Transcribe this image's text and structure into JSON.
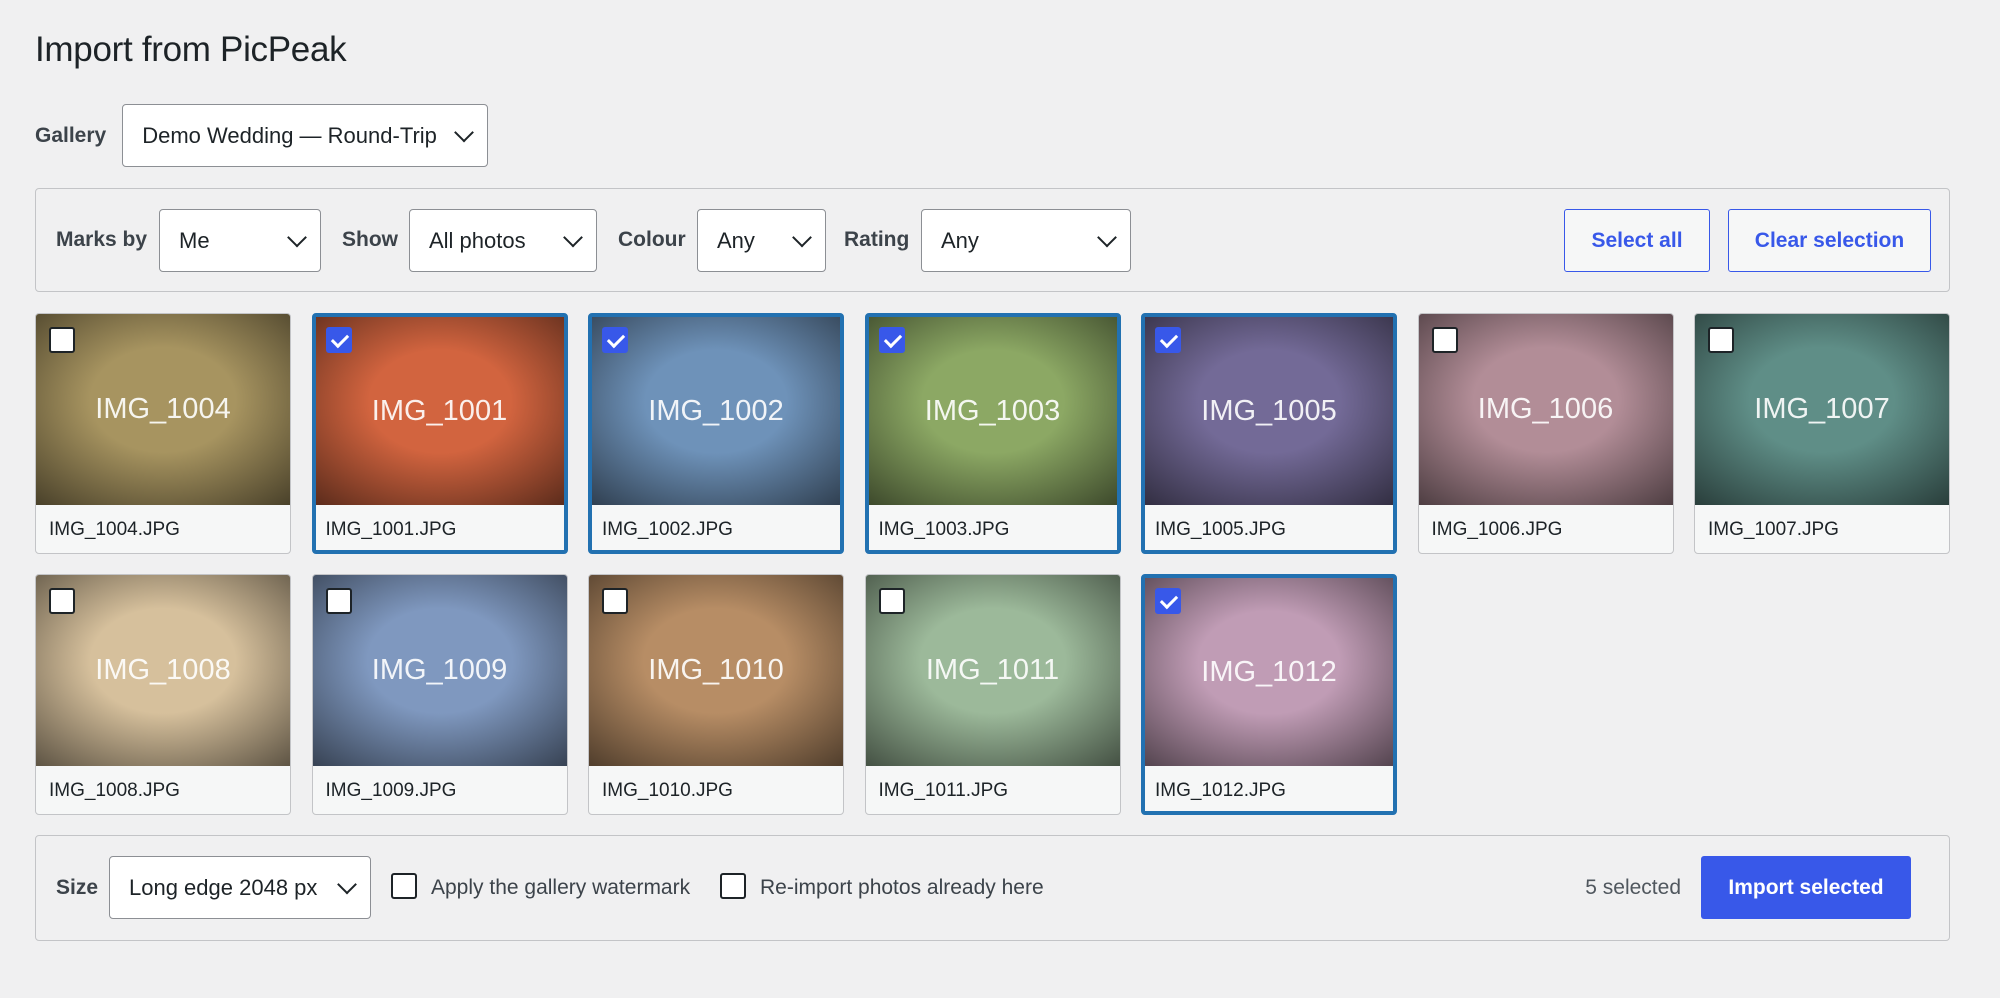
{
  "page": {
    "title": "Import from PicPeak"
  },
  "gallery": {
    "label": "Gallery",
    "value": "Demo Wedding — Round-Trip"
  },
  "filters": {
    "marks_by": {
      "label": "Marks by",
      "value": "Me"
    },
    "show": {
      "label": "Show",
      "value": "All photos"
    },
    "colour": {
      "label": "Colour",
      "value": "Any"
    },
    "rating": {
      "label": "Rating",
      "value": "Any"
    },
    "select_all_label": "Select all",
    "clear_selection_label": "Clear selection"
  },
  "photos": [
    {
      "thumb_label": "IMG_1004",
      "filename": "IMG_1004.JPG",
      "selected": false,
      "color": "#a79460"
    },
    {
      "thumb_label": "IMG_1001",
      "filename": "IMG_1001.JPG",
      "selected": true,
      "color": "#d2643f"
    },
    {
      "thumb_label": "IMG_1002",
      "filename": "IMG_1002.JPG",
      "selected": true,
      "color": "#6e92b9"
    },
    {
      "thumb_label": "IMG_1003",
      "filename": "IMG_1003.JPG",
      "selected": true,
      "color": "#8ca864"
    },
    {
      "thumb_label": "IMG_1005",
      "filename": "IMG_1005.JPG",
      "selected": true,
      "color": "#736a97"
    },
    {
      "thumb_label": "IMG_1006",
      "filename": "IMG_1006.JPG",
      "selected": false,
      "color": "#b28d97"
    },
    {
      "thumb_label": "IMG_1007",
      "filename": "IMG_1007.JPG",
      "selected": false,
      "color": "#5f8e87"
    },
    {
      "thumb_label": "IMG_1008",
      "filename": "IMG_1008.JPG",
      "selected": false,
      "color": "#d6c09c"
    },
    {
      "thumb_label": "IMG_1009",
      "filename": "IMG_1009.JPG",
      "selected": false,
      "color": "#7f98bf"
    },
    {
      "thumb_label": "IMG_1010",
      "filename": "IMG_1010.JPG",
      "selected": false,
      "color": "#b78d65"
    },
    {
      "thumb_label": "IMG_1011",
      "filename": "IMG_1011.JPG",
      "selected": false,
      "color": "#9cb99a"
    },
    {
      "thumb_label": "IMG_1012",
      "filename": "IMG_1012.JPG",
      "selected": true,
      "color": "#c09cb5"
    }
  ],
  "footer": {
    "size": {
      "label": "Size",
      "value": "Long edge 2048 px"
    },
    "watermark_label": "Apply the gallery watermark",
    "reimport_label": "Re-import photos already here",
    "selected_count": "5 selected",
    "import_label": "Import selected"
  }
}
